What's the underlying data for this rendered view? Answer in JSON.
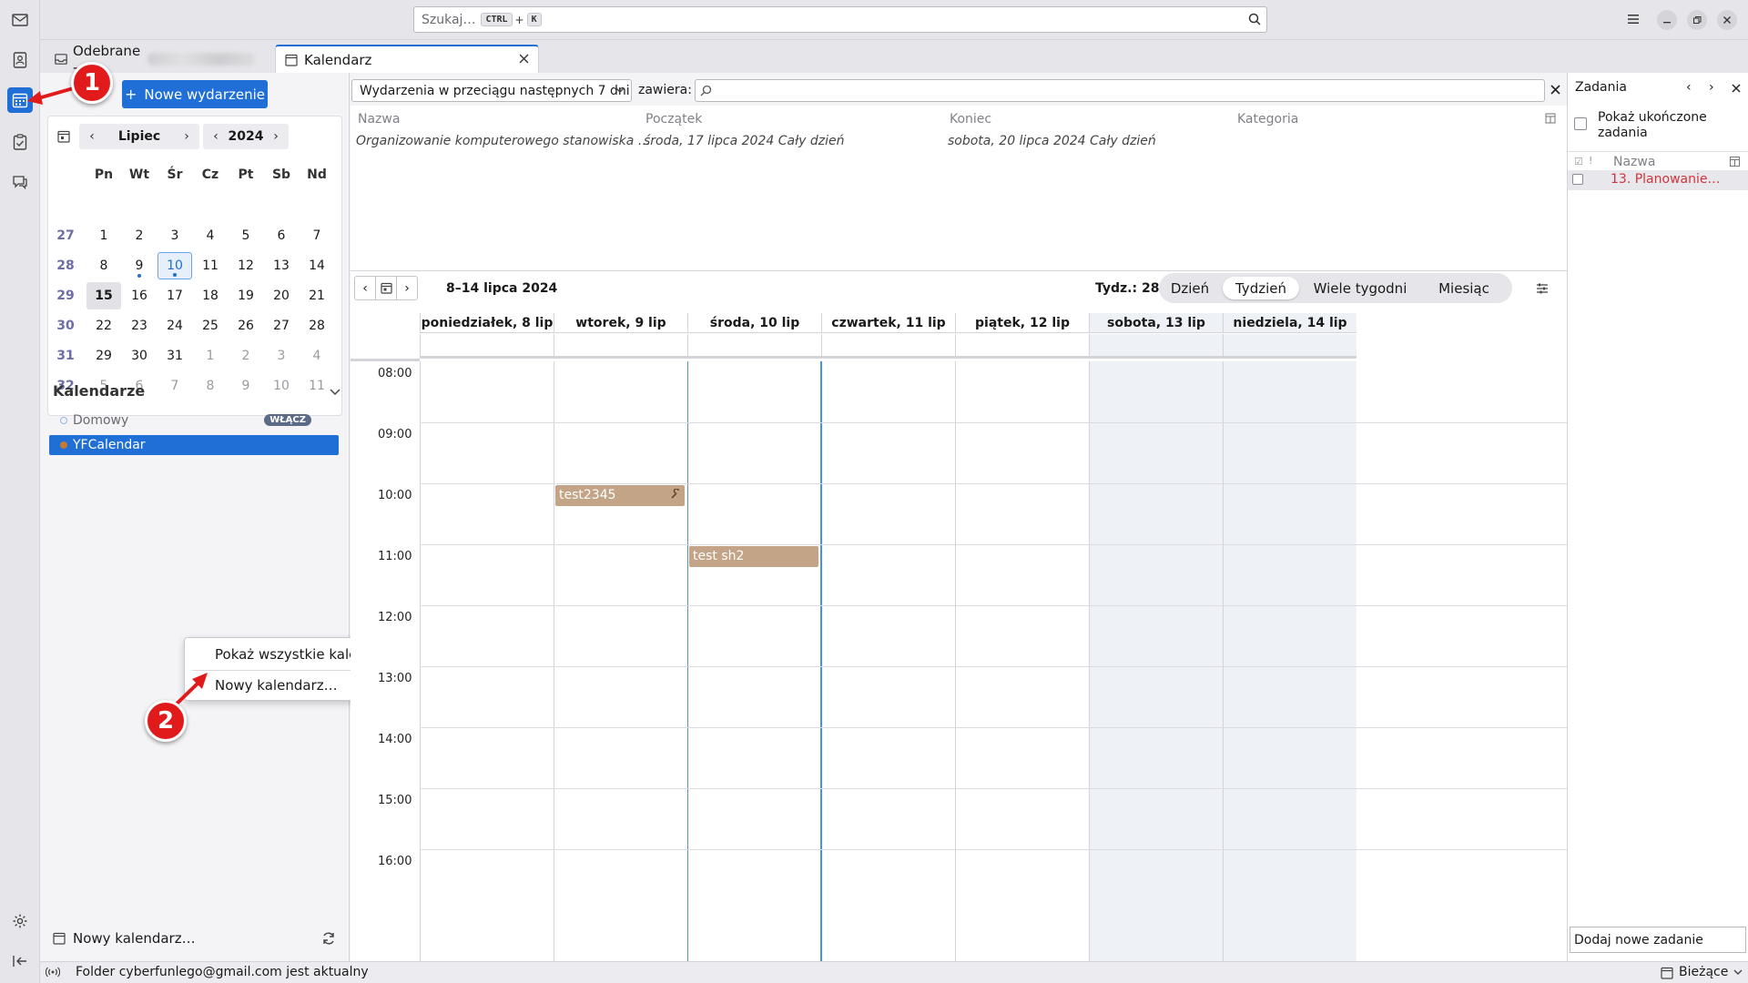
{
  "search": {
    "placeholder": "Szukaj…",
    "key1": "CTRL",
    "plus": "+",
    "key2": "K"
  },
  "tabs": [
    {
      "label": "Odebrane -",
      "icon": "inbox-icon"
    },
    {
      "label": "Kalendarz",
      "icon": "calendar-icon"
    }
  ],
  "left": {
    "new_event": "Nowe wydarzenie",
    "month": "Lipiec",
    "year": "2024",
    "dow": [
      "Pn",
      "Wt",
      "Śr",
      "Cz",
      "Pt",
      "Sb",
      "Nd"
    ],
    "weeks": [
      {
        "wk": "27",
        "days": [
          "1",
          "2",
          "3",
          "4",
          "5",
          "6",
          "7"
        ]
      },
      {
        "wk": "28",
        "days": [
          "8",
          "9",
          "10",
          "11",
          "12",
          "13",
          "14"
        ]
      },
      {
        "wk": "29",
        "days": [
          "15",
          "16",
          "17",
          "18",
          "19",
          "20",
          "21"
        ]
      },
      {
        "wk": "30",
        "days": [
          "22",
          "23",
          "24",
          "25",
          "26",
          "27",
          "28"
        ]
      },
      {
        "wk": "31",
        "days": [
          "29",
          "30",
          "31",
          "1",
          "2",
          "3",
          "4"
        ]
      },
      {
        "wk": "32",
        "days": [
          "5",
          "6",
          "7",
          "8",
          "9",
          "10",
          "11"
        ]
      }
    ],
    "calendars_heading": "Kalendarze",
    "calendars": [
      {
        "name": "Domowy",
        "badge": "WŁĄCZ",
        "color": "#8fb4e3"
      },
      {
        "name": "YFCalendar",
        "color": "#c47a33"
      }
    ],
    "new_calendar": "Nowy kalendarz…"
  },
  "context_menu": {
    "show_all": "Pokaż wszystkie kalendarze",
    "new_calendar": "Nowy kalendarz…"
  },
  "annotations": {
    "badge1": "1",
    "badge2": "2"
  },
  "filter": {
    "range": "Wydarzenia w przeciągu następnych 7 dni",
    "contains": "zawiera:"
  },
  "event_list": {
    "headers": {
      "name": "Nazwa",
      "start": "Początek",
      "end": "Koniec",
      "category": "Kategoria"
    },
    "rows": [
      {
        "name": "Organizowanie komputerowego stanowiska …",
        "start": "środa, 17 lipca 2024 Cały dzień",
        "end": "sobota, 20 lipca 2024 Cały dzień",
        "category": ""
      }
    ]
  },
  "view": {
    "range": "8–14 lipca 2024",
    "week_label": "Tydz.: 28",
    "modes": [
      "Dzień",
      "Tydzień",
      "Wiele tygodni",
      "Miesiąc"
    ],
    "selected_mode": "Tydzień"
  },
  "week": {
    "days": [
      "poniedziałek, 8 lip",
      "wtorek, 9 lip",
      "środa, 10 lip",
      "czwartek, 11 lip",
      "piątek, 12 lip",
      "sobota, 13 lip",
      "niedziela, 14 lip"
    ],
    "hours": [
      "08:00",
      "09:00",
      "10:00",
      "11:00",
      "12:00",
      "13:00",
      "14:00",
      "15:00",
      "16:00"
    ],
    "events": [
      {
        "title": "test2345",
        "day": "wtorek, 9 lip",
        "start": "10:00"
      },
      {
        "title": "test sh2",
        "day": "środa, 10 lip",
        "start": "11:00"
      }
    ]
  },
  "tasks": {
    "title": "Zadania",
    "show_completed": "Pokaż ukończone zadania",
    "column": "Nazwa",
    "items": [
      {
        "title": "13. Planowanie…",
        "color": "#d0343a"
      }
    ],
    "add_placeholder": "Dodaj nowe zadanie"
  },
  "status": {
    "message": "Folder cyberfunlego@gmail.com jest aktualny",
    "today_pane": "Bieżące"
  }
}
